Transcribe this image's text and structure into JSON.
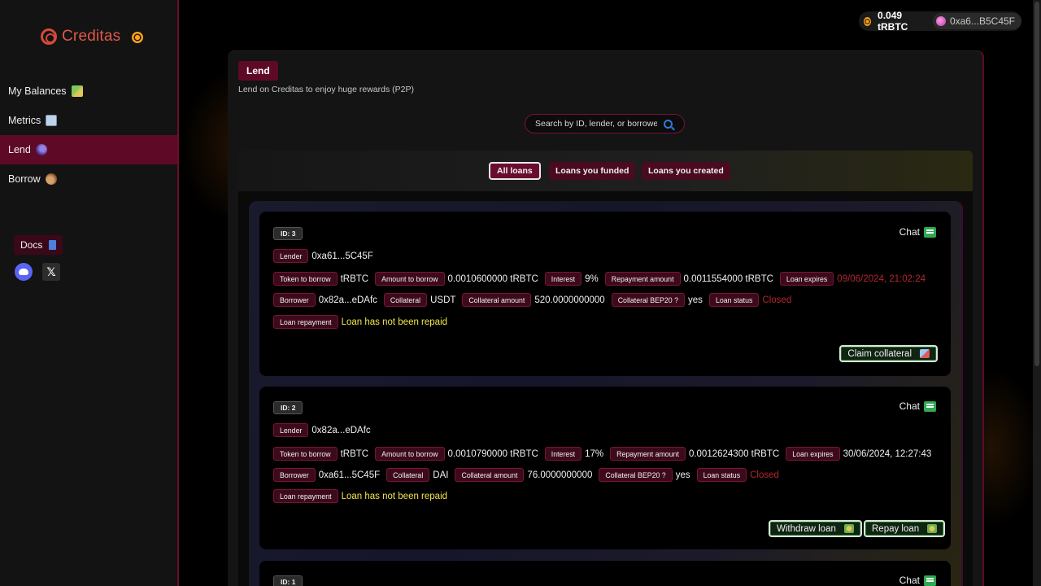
{
  "brand": {
    "name": "Creditas"
  },
  "sidebar": {
    "items": [
      {
        "label": "My Balances"
      },
      {
        "label": "Metrics"
      },
      {
        "label": "Lend"
      },
      {
        "label": "Borrow"
      }
    ],
    "docs_label": "Docs",
    "x_glyph": "𝕏"
  },
  "wallet": {
    "balance": "0.049 tRBTC",
    "address": "0xa6...B5C45F"
  },
  "page": {
    "title": "Lend",
    "subtitle": "Lend on Creditas to enjoy huge rewards (P2P)",
    "search_placeholder": "Search by ID, lender, or borrower..."
  },
  "tabs": [
    {
      "label": "All loans",
      "active": true
    },
    {
      "label": "Loans you funded",
      "active": false
    },
    {
      "label": "Loans you created",
      "active": false
    }
  ],
  "labels": {
    "lender": "Lender",
    "token_to_borrow": "Token to borrow",
    "amount_to_borrow": "Amount to borrow",
    "interest": "Interest",
    "repayment_amount": "Repayment amount",
    "loan_expires": "Loan expires",
    "borrower": "Borrower",
    "collateral": "Collateral",
    "collateral_amount": "Collateral amount",
    "collateral_bep20": "Collateral BEP20 ?",
    "loan_status": "Loan status",
    "loan_repayment": "Loan repayment",
    "chat": "Chat"
  },
  "loans": [
    {
      "id": "ID: 3",
      "lender": "0xa61...5C45F",
      "token": "tRBTC",
      "amount": "0.0010600000 tRBTC",
      "interest": "9%",
      "repayment": "0.0011554000 tRBTC",
      "expires": "09/06/2024, 21:02:24",
      "borrower": "0x82a...eDAfc",
      "collateral": "USDT",
      "collateral_amount": "520.0000000000",
      "bep20": "yes",
      "status": "Closed",
      "repayment_status": "Loan has not been repaid",
      "actions": [
        {
          "label": "Claim collateral"
        }
      ]
    },
    {
      "id": "ID: 2",
      "lender": "0x82a...eDAfc",
      "token": "tRBTC",
      "amount": "0.0010790000 tRBTC",
      "interest": "17%",
      "repayment": "0.0012624300 tRBTC",
      "expires": "30/06/2024, 12:27:43",
      "borrower": "0xa61...5C45F",
      "collateral": "DAI",
      "collateral_amount": "76.0000000000",
      "bep20": "yes",
      "status": "Closed",
      "repayment_status": "Loan has not been repaid",
      "actions": [
        {
          "label": "Withdraw loan"
        },
        {
          "label": "Repay loan"
        }
      ]
    },
    {
      "id": "ID: 1"
    }
  ],
  "colors": {
    "accent": "#5e0a27",
    "expired_red": "#b3262e",
    "warning_yellow": "#f2e64b",
    "brand": "#e0584a"
  }
}
